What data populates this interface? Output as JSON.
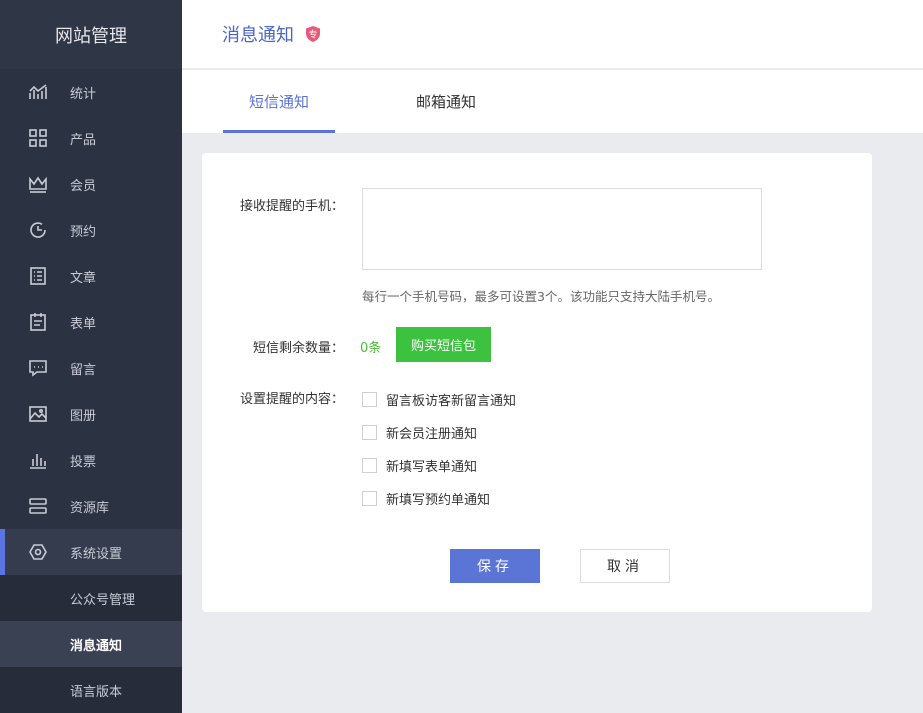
{
  "sidebar": {
    "title": "网站管理",
    "items": [
      {
        "label": "统计",
        "icon": "chart-line-icon"
      },
      {
        "label": "产品",
        "icon": "grid-icon"
      },
      {
        "label": "会员",
        "icon": "crown-icon"
      },
      {
        "label": "预约",
        "icon": "clock-icon"
      },
      {
        "label": "文章",
        "icon": "list-document-icon"
      },
      {
        "label": "表单",
        "icon": "clipboard-icon"
      },
      {
        "label": "留言",
        "icon": "message-icon"
      },
      {
        "label": "图册",
        "icon": "image-icon"
      },
      {
        "label": "投票",
        "icon": "bar-chart-icon"
      },
      {
        "label": "资源库",
        "icon": "storage-icon"
      },
      {
        "label": "系统设置",
        "icon": "gear-icon"
      }
    ],
    "sub_items": [
      {
        "label": "公众号管理"
      },
      {
        "label": "消息通知"
      },
      {
        "label": "语言版本"
      }
    ]
  },
  "header": {
    "title": "消息通知",
    "badge": "专"
  },
  "tabs": [
    {
      "label": "短信通知"
    },
    {
      "label": "邮箱通知"
    }
  ],
  "form": {
    "phone_label": "接收提醒的手机：",
    "phone_value": "",
    "hint": "每行一个手机号码，最多可设置3个。该功能只支持大陆手机号。",
    "sms_label": "短信剩余数量：",
    "sms_count": "0条",
    "buy_button": "购买短信包",
    "content_label": "设置提醒的内容：",
    "options": [
      {
        "label": "留言板访客新留言通知"
      },
      {
        "label": "新会员注册通知"
      },
      {
        "label": "新填写表单通知"
      },
      {
        "label": "新填写预约单通知"
      }
    ],
    "save_button": "保存",
    "cancel_button": "取消"
  },
  "colors": {
    "sidebar_bg": "#2b3242",
    "accent": "#5b75d6",
    "green": "#3cc23e",
    "badge": "#e85a7a"
  }
}
